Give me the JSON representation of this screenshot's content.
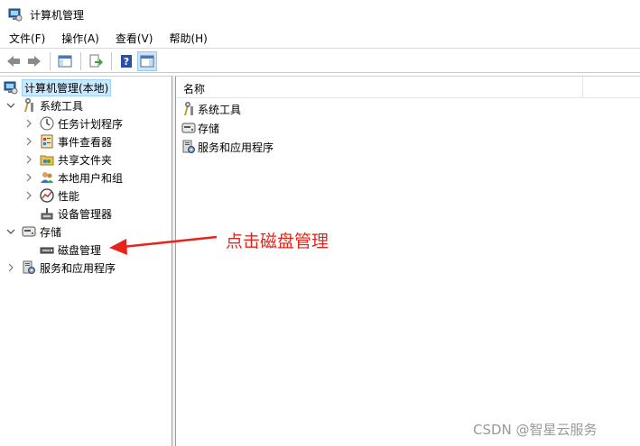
{
  "window": {
    "title": "计算机管理"
  },
  "menu": [
    "文件(F)",
    "操作(A)",
    "查看(V)",
    "帮助(H)"
  ],
  "toolbar": {
    "buttons": [
      "back-icon",
      "forward-icon",
      "show-hide-tree-icon",
      "export-list-icon",
      "help-icon",
      "show-action-pane-icon"
    ]
  },
  "tree": {
    "root": "计算机管理(本地)",
    "system_tools": "系统工具",
    "task_scheduler": "任务计划程序",
    "event_viewer": "事件查看器",
    "shared_folders": "共享文件夹",
    "local_users": "本地用户和组",
    "performance": "性能",
    "device_manager": "设备管理器",
    "storage": "存储",
    "disk_management": "磁盘管理",
    "services": "服务和应用程序"
  },
  "list": {
    "column_name": "名称",
    "items": [
      "系统工具",
      "存储",
      "服务和应用程序"
    ]
  },
  "annotation": "点击磁盘管理",
  "watermark": "CSDN @智星云服务",
  "colors": {
    "selection": "#cce8ff",
    "annotation": "#e8241a"
  }
}
